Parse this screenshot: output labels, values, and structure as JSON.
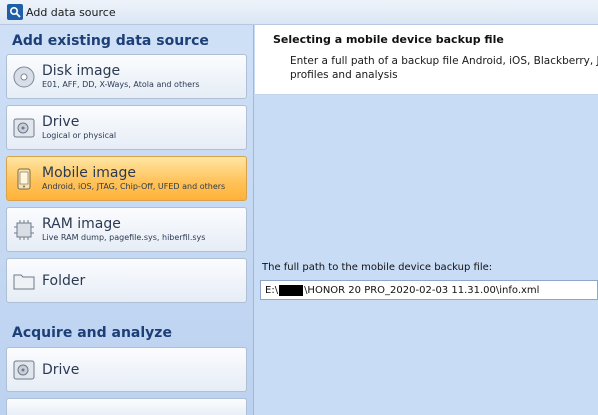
{
  "window": {
    "title": "Add data source",
    "icon": "search-icon"
  },
  "sidebar": {
    "existing_heading": "Add existing data source",
    "existing_items": [
      {
        "label": "Disk image",
        "sub": "E01, AFF, DD, X-Ways, Atola and others",
        "icon": "disk-image-icon",
        "selected": false
      },
      {
        "label": "Drive",
        "sub": "Logical or physical",
        "icon": "drive-icon",
        "selected": false
      },
      {
        "label": "Mobile image",
        "sub": "Android, iOS, JTAG, Chip-Off, UFED and others",
        "icon": "mobile-phone-icon",
        "selected": true
      },
      {
        "label": "RAM image",
        "sub": "Live RAM dump, pagefile.sys, hiberfil.sys",
        "icon": "ram-chip-icon",
        "selected": false
      },
      {
        "label": "Folder",
        "sub": "",
        "icon": "folder-icon",
        "selected": false
      }
    ],
    "acquire_heading": "Acquire and analyze",
    "acquire_items": [
      {
        "label": "Drive",
        "icon": "drive-icon"
      }
    ]
  },
  "panel": {
    "heading": "Selecting a mobile device backup file",
    "description_line1": "Enter a full path of a backup file Android, iOS, Blackberry, JTAG",
    "description_line2": "profiles and analysis",
    "path_label": "The full path to the mobile device backup file:",
    "path_prefix": "E:\\",
    "path_suffix": "\\HONOR 20 PRO_2020-02-03 11.31.00\\info.xml"
  },
  "colors": {
    "accent": "#1d3f78",
    "selected": "#ffc45c",
    "background": "#c9dcf5"
  }
}
